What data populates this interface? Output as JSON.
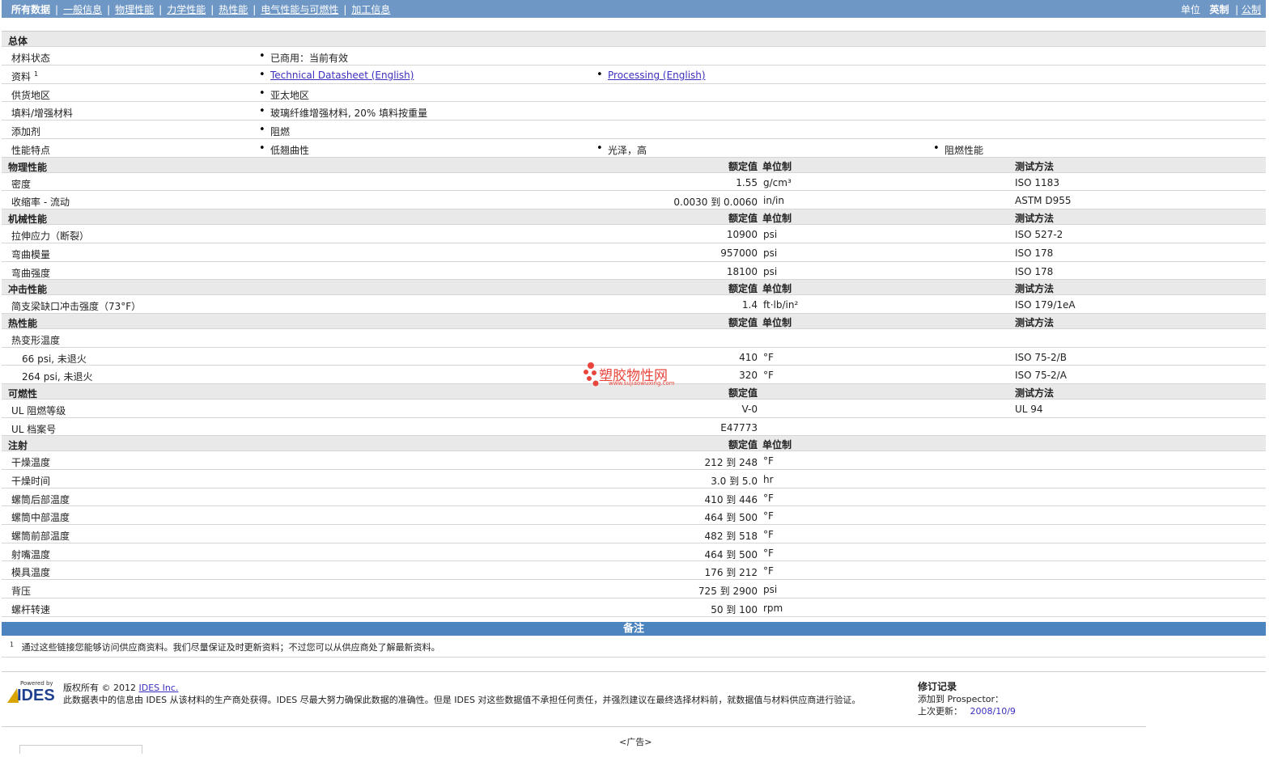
{
  "nav": {
    "tabs": [
      "所有数据",
      "一般信息",
      "物理性能",
      "力学性能",
      "热性能",
      "电气性能与可燃性",
      "加工信息"
    ],
    "units_label": "单位",
    "unit_english": "英制",
    "unit_metric": "公制"
  },
  "general": {
    "title": "总体",
    "rows": [
      {
        "label": "材料状态",
        "values": [
          "已商用：当前有效"
        ]
      },
      {
        "label": "资料",
        "sup": "1",
        "values": [
          "Technical Datasheet (English)",
          "Processing (English)"
        ],
        "links": true
      },
      {
        "label": "供货地区",
        "values": [
          "亚太地区"
        ]
      },
      {
        "label": "填料/增强材料",
        "values": [
          "玻璃纤维增强材料, 20% 填料按重量"
        ]
      },
      {
        "label": "添加剂",
        "values": [
          "阻燃"
        ]
      },
      {
        "label": "性能特点",
        "values": [
          "低翘曲性",
          "光泽，高",
          "阻燃性能"
        ]
      }
    ]
  },
  "headers": {
    "value": "额定值",
    "unit": "单位制",
    "method": "测试方法"
  },
  "physical": {
    "title": "物理性能",
    "rows": [
      {
        "label": "密度",
        "value": "1.55",
        "unit": "g/cm³",
        "method": "ISO 1183"
      },
      {
        "label": "收缩率 - 流动",
        "value": "0.0030 到  0.0060",
        "unit": "in/in",
        "method": "ASTM D955"
      }
    ]
  },
  "mechanical": {
    "title": "机械性能",
    "rows": [
      {
        "label": "拉伸应力（断裂）",
        "value": "10900",
        "unit": "psi",
        "method": "ISO 527-2"
      },
      {
        "label": "弯曲模量",
        "value": "957000",
        "unit": "psi",
        "method": "ISO 178"
      },
      {
        "label": "弯曲强度",
        "value": "18100",
        "unit": "psi",
        "method": "ISO 178"
      }
    ]
  },
  "impact": {
    "title": "冲击性能",
    "rows": [
      {
        "label": "简支梁缺口冲击强度（73°F）",
        "value": "1.4",
        "unit": "ft·lb/in²",
        "method": "ISO 179/1eA"
      }
    ]
  },
  "thermal": {
    "title": "热性能",
    "rows": [
      {
        "label": "热变形温度",
        "value": "",
        "unit": "",
        "method": ""
      },
      {
        "label": "66 psi, 未退火",
        "value": "410",
        "unit": "°F",
        "method": "ISO 75-2/B",
        "indent": true
      },
      {
        "label": "264 psi, 未退火",
        "value": "320",
        "unit": "°F",
        "method": "ISO 75-2/A",
        "indent": true
      }
    ]
  },
  "flammability": {
    "title": "可燃性",
    "rows": [
      {
        "label": "UL 阻燃等级",
        "value": "V-0",
        "unit": "",
        "method": "UL 94"
      },
      {
        "label": "UL 档案号",
        "value": "E47773",
        "unit": "",
        "method": ""
      }
    ]
  },
  "injection": {
    "title": "注射",
    "rows": [
      {
        "label": "干燥温度",
        "value": "212 到  248",
        "unit": "°F"
      },
      {
        "label": "干燥时间",
        "value": "3.0 到  5.0",
        "unit": "hr"
      },
      {
        "label": "螺筒后部温度",
        "value": "410 到  446",
        "unit": "°F"
      },
      {
        "label": "螺筒中部温度",
        "value": "464 到  500",
        "unit": "°F"
      },
      {
        "label": "螺筒前部温度",
        "value": "482 到  518",
        "unit": "°F"
      },
      {
        "label": "射嘴温度",
        "value": "464 到  500",
        "unit": "°F"
      },
      {
        "label": "模具温度",
        "value": "176 到  212",
        "unit": "°F"
      },
      {
        "label": "背压",
        "value": "725 到  2900",
        "unit": "psi"
      },
      {
        "label": "螺杆转速",
        "value": "50 到  100",
        "unit": "rpm"
      }
    ]
  },
  "notes": {
    "title": "备注",
    "footnote_mark": "1",
    "footnote": "通过这些链接您能够访问供应商资料。我们尽量保证及时更新资料；不过您可以从供应商处了解最新资料。"
  },
  "footer": {
    "logo_small": "Powered by",
    "logo_text": "IDES",
    "copyright_prefix": "版权所有  © 2012",
    "copyright_link": "IDES Inc.",
    "disclaimer": "此数据表中的信息由  IDES 从该材料的生产商处获得。IDES 尽最大努力确保此数据的准确性。但是  IDES 对这些数据值不承担任何责任，并强烈建议在最终选择材料前，就数据值与材料供应商进行验证。",
    "rev_title": "修订记录",
    "rev_added_label": "添加到  Prospector：",
    "rev_updated_label": "上次更新：",
    "rev_updated_value": "2008/10/9",
    "ad": "<广告>"
  },
  "watermark": {
    "text": "塑胶物性网",
    "url": "www.sujiaowuxing.com"
  }
}
